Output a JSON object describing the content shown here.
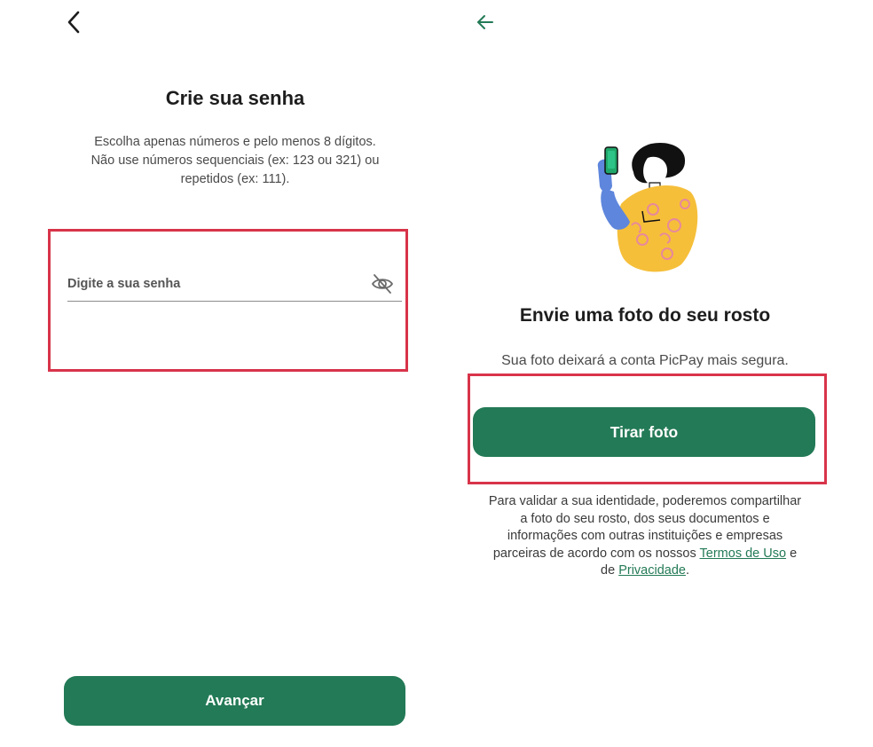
{
  "colors": {
    "primary": "#237a56",
    "highlight": "#d8344a",
    "text_dark": "#1d1d1d",
    "text_muted": "#4a4a4a",
    "background": "#ffffff"
  },
  "icons": {
    "left_back": "chevron-left-icon",
    "password_toggle": "eye-off-icon",
    "right_back": "arrow-left-icon",
    "illustration": "selfie-illustration"
  },
  "password_screen": {
    "title": "Crie sua senha",
    "instructions": [
      "Escolha apenas números e pelo menos 8 dígitos.",
      "Não use números sequenciais (ex: 123 ou 321) ou",
      "repetidos (ex: 111)."
    ],
    "password_field": {
      "value": "",
      "placeholder": "Digite a sua senha"
    },
    "advance_button": "Avançar"
  },
  "photo_screen": {
    "title": "Envie uma foto do seu rosto",
    "subtitle": "Sua foto deixará a conta PicPay mais segura.",
    "take_photo_button": "Tirar foto",
    "legal": {
      "text_before": "Para validar a sua identidade, poderemos compartilhar a foto do seu rosto, dos seus documentos e informações com outras instituições e empresas parceiras de acordo com os nossos ",
      "terms_link": "Termos de Uso",
      "conjunction": " e de ",
      "privacy_link": "Privacidade",
      "end": "."
    }
  }
}
